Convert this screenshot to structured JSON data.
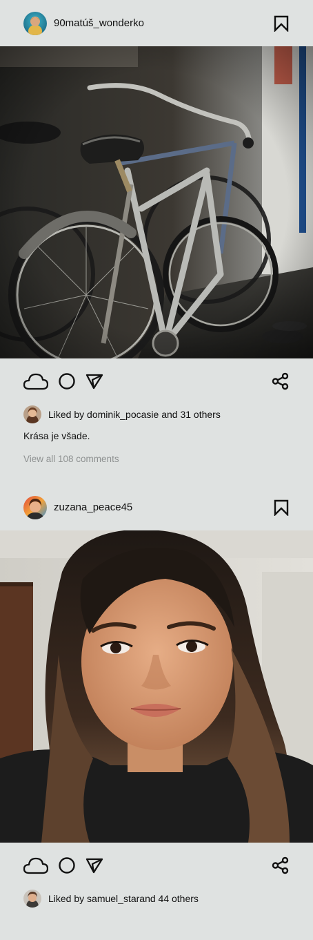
{
  "posts": [
    {
      "username": "90matúš_wonderko",
      "photo_alt": "Bicycles in a garage",
      "liked_by_text": "Liked by dominik_pocasie and 31 others",
      "caption": "Krása je všade.",
      "comments_link": "View all 108 comments"
    },
    {
      "username": "zuzana_peace45",
      "photo_alt": "Portrait selfie of a woman",
      "liked_by_text": "Liked by samuel_starand 44 others"
    }
  ],
  "icons": {
    "like": "cloud-icon",
    "comment": "circle-icon",
    "share_direct": "send-triangle-icon",
    "share": "share-nodes-icon",
    "bookmark": "bookmark-icon"
  },
  "colors": {
    "background": "#dfe2e1",
    "text": "#111111",
    "muted": "#8e9191"
  }
}
